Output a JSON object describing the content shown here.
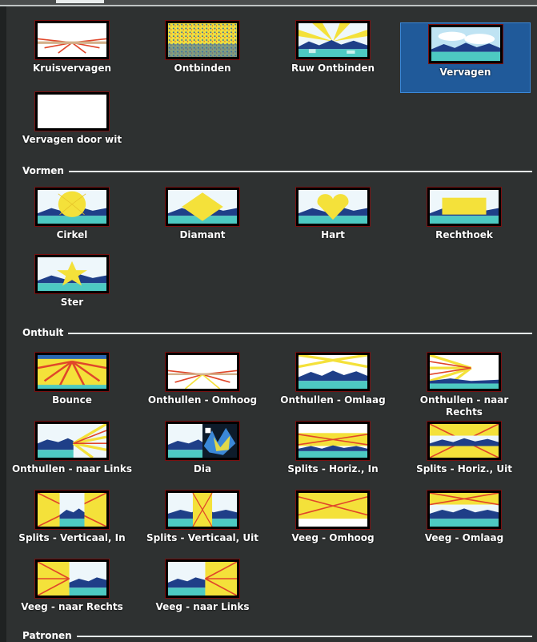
{
  "sections": {
    "vormen": "Vormen",
    "onthult": "Onthult",
    "patronen": "Patronen"
  },
  "top": [
    {
      "label": "Kruisvervagen",
      "icon": "cross-fade-preview-icon"
    },
    {
      "label": "Ontbinden",
      "icon": "dissolve-preview-icon"
    },
    {
      "label": "Ruw Ontbinden",
      "icon": "rough-dissolve-preview-icon"
    },
    {
      "label": "Vervagen",
      "icon": "fade-preview-icon"
    },
    {
      "label": "Vervagen door wit",
      "icon": "fade-through-white-preview-icon"
    }
  ],
  "vormen": [
    {
      "label": "Cirkel",
      "icon": "circle-preview-icon"
    },
    {
      "label": "Diamant",
      "icon": "diamond-preview-icon"
    },
    {
      "label": "Hart",
      "icon": "heart-preview-icon"
    },
    {
      "label": "Rechthoek",
      "icon": "rectangle-preview-icon"
    },
    {
      "label": "Ster",
      "icon": "star-preview-icon"
    }
  ],
  "onthult": [
    {
      "label": "Bounce",
      "icon": "bounce-preview-icon"
    },
    {
      "label": "Onthullen - Omhoog",
      "icon": "reveal-up-preview-icon"
    },
    {
      "label": "Onthullen - Omlaag",
      "icon": "reveal-down-preview-icon"
    },
    {
      "label": "Onthullen - naar Rechts",
      "icon": "reveal-right-preview-icon"
    },
    {
      "label": "Onthullen - naar Links",
      "icon": "reveal-left-preview-icon"
    },
    {
      "label": "Dia",
      "icon": "slide-preview-icon"
    },
    {
      "label": "Splits - Horiz., In",
      "icon": "split-horizontal-in-preview-icon"
    },
    {
      "label": "Splits - Horiz., Uit",
      "icon": "split-horizontal-out-preview-icon"
    },
    {
      "label": "Splits - Verticaal, In",
      "icon": "split-vertical-in-preview-icon"
    },
    {
      "label": "Splits - Verticaal, Uit",
      "icon": "split-vertical-out-preview-icon"
    },
    {
      "label": "Veeg - Omhoog",
      "icon": "wipe-up-preview-icon"
    },
    {
      "label": "Veeg - Omlaag",
      "icon": "wipe-down-preview-icon"
    },
    {
      "label": "Veeg - naar Rechts",
      "icon": "wipe-right-preview-icon"
    },
    {
      "label": "Veeg - naar Links",
      "icon": "wipe-left-preview-icon"
    }
  ],
  "selected": "Vervagen",
  "colors": {
    "background": "#2e3131",
    "selection": "#205a9a",
    "selection_border": "#3b88d8",
    "sunburst_yellow": "#f4e13a",
    "sunburst_red": "#e0462a",
    "water": "#2a66b0",
    "mountain": "#1f3f88"
  }
}
